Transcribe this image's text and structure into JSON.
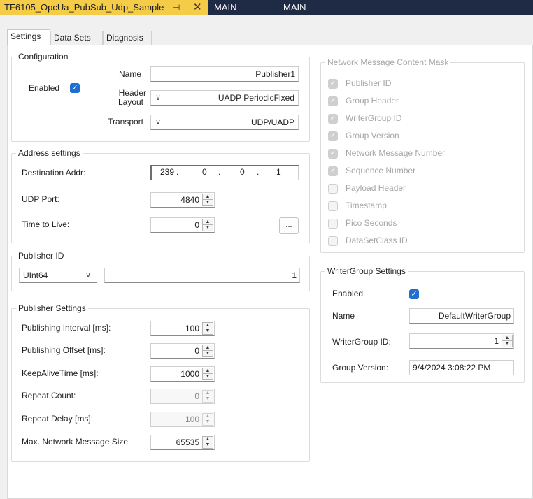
{
  "doc_tabs": {
    "active": "TF6105_OpcUa_PubSub_Udp_Sample",
    "tab2": "MAIN",
    "tab3": "MAIN"
  },
  "tabs": {
    "settings": "Settings",
    "datasets": "Data Sets",
    "diagnosis": "Diagnosis"
  },
  "configuration": {
    "legend": "Configuration",
    "enabled_label": "Enabled",
    "name_label": "Name",
    "name_value": "Publisher1",
    "header_label_1": "Header",
    "header_label_2": "Layout",
    "header_value": "UADP PeriodicFixed",
    "transport_label": "Transport",
    "transport_value": "UDP/UADP"
  },
  "address": {
    "legend": "Address settings",
    "dest_label": "Destination Addr:",
    "ip": [
      "239",
      "0",
      "0",
      "1"
    ],
    "udp_label": "UDP Port:",
    "udp_value": "4840",
    "ttl_label": "Time to Live:",
    "ttl_value": "0",
    "dots": "..."
  },
  "publisher_id": {
    "legend": "Publisher ID",
    "type_value": "UInt64",
    "id_value": "1"
  },
  "publisher_settings": {
    "legend": "Publisher Settings",
    "rows": [
      {
        "label": "Publishing Interval [ms]:",
        "value": "100"
      },
      {
        "label": "Publishing Offset [ms]:",
        "value": "0"
      },
      {
        "label": "KeepAliveTime [ms]:",
        "value": "1000"
      },
      {
        "label": "Repeat Count:",
        "value": "0"
      },
      {
        "label": "Repeat Delay [ms]:",
        "value": "100"
      },
      {
        "label": "Max. Network Message Size",
        "value": "65535"
      }
    ]
  },
  "mask": {
    "legend": "Network Message Content Mask",
    "items": [
      {
        "label": "Publisher ID",
        "checked": true
      },
      {
        "label": "Group Header",
        "checked": true
      },
      {
        "label": "WriterGroup ID",
        "checked": true
      },
      {
        "label": "Group Version",
        "checked": true
      },
      {
        "label": "Network Message Number",
        "checked": true
      },
      {
        "label": "Sequence Number",
        "checked": true
      },
      {
        "label": "Payload Header",
        "checked": false
      },
      {
        "label": "Timestamp",
        "checked": false
      },
      {
        "label": "Pico Seconds",
        "checked": false
      },
      {
        "label": "DataSetClass ID",
        "checked": false
      }
    ]
  },
  "writer_group": {
    "legend": "WriterGroup Settings",
    "enabled_label": "Enabled",
    "name_label": "Name",
    "name_value": "DefaultWriterGroup",
    "id_label": "WriterGroup ID:",
    "id_value": "1",
    "version_label": "Group Version:",
    "version_value": "9/4/2024 3:08:22 PM"
  },
  "glyphs": {
    "pin": "⊣",
    "close": "✕",
    "check": "✓",
    "chevron": "∨",
    "spin_up": "▲",
    "spin_down": "▼"
  },
  "colors": {
    "active_doc_tab": "#f5cc47",
    "tabstrip": "#1f2a44",
    "checkbox": "#1e6fd0"
  }
}
